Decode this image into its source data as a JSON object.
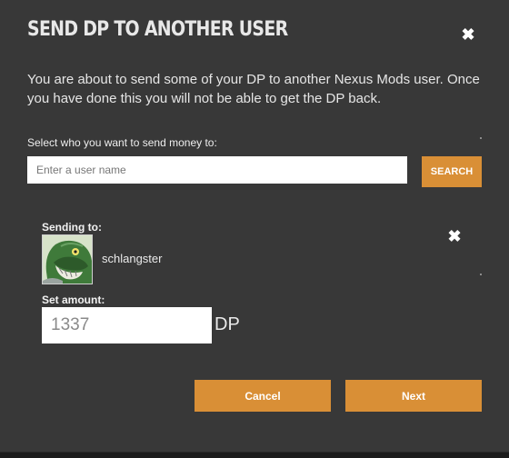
{
  "dialog": {
    "title": "SEND DP TO ANOTHER USER",
    "close_icon": "close-icon",
    "intro": "You are about to send some of your DP to another Nexus Mods user. Once you have done this you will not be able to get the DP back."
  },
  "search": {
    "label": "Select who you want to send money to:",
    "placeholder": "Enter a user name",
    "value": "",
    "button_label": "SEARCH"
  },
  "recipient": {
    "label": "Sending to:",
    "username": "schlangster",
    "avatar_icon": "avatar-image",
    "remove_icon": "close-icon"
  },
  "amount": {
    "label": "Set amount:",
    "value": "1337",
    "unit": "DP"
  },
  "actions": {
    "cancel_label": "Cancel",
    "next_label": "Next"
  },
  "colors": {
    "modal_bg": "#383838",
    "accent": "#d98f36",
    "text": "#e6e6e6"
  }
}
